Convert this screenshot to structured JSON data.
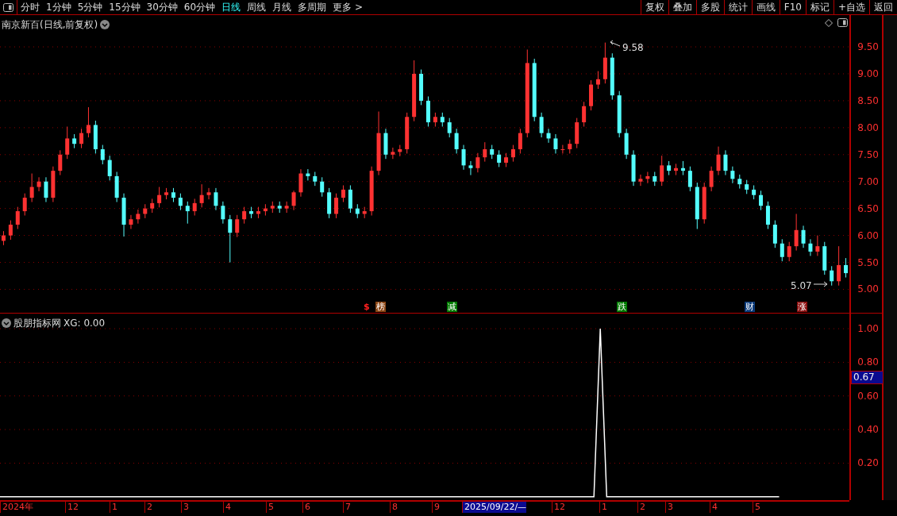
{
  "toolbar": {
    "periods": [
      {
        "label": "分时",
        "selected": false
      },
      {
        "label": "1分钟",
        "selected": false
      },
      {
        "label": "5分钟",
        "selected": false
      },
      {
        "label": "15分钟",
        "selected": false
      },
      {
        "label": "30分钟",
        "selected": false
      },
      {
        "label": "60分钟",
        "selected": false
      },
      {
        "label": "日线",
        "selected": true
      },
      {
        "label": "周线",
        "selected": false
      },
      {
        "label": "月线",
        "selected": false
      },
      {
        "label": "多周期",
        "selected": false
      }
    ],
    "more": "更多 >",
    "buttons": [
      "复权",
      "叠加",
      "多股",
      "统计",
      "画线",
      "F10",
      "标记",
      "+自选",
      "返回"
    ]
  },
  "price_pane": {
    "title": "南京新百(日线,前复权)",
    "high_label": "9.58",
    "low_label": "5.07",
    "chart_data": {
      "type": "candlestick",
      "ylim": [
        4.55,
        10.09
      ],
      "grid": true,
      "yticks": [
        {
          "value": 9.5,
          "label": "9.50"
        },
        {
          "value": 9,
          "label": "9.00"
        },
        {
          "value": 8.5,
          "label": "8.50"
        },
        {
          "value": 8,
          "label": "8.00"
        },
        {
          "value": 7.5,
          "label": "7.50"
        },
        {
          "value": 7,
          "label": "7.00"
        },
        {
          "value": 6.5,
          "label": "6.50"
        },
        {
          "value": 6,
          "label": "6.00"
        },
        {
          "value": 5.5,
          "label": "5.50"
        },
        {
          "value": 5,
          "label": "5.00"
        }
      ],
      "categories": [
        null,
        null,
        null,
        null,
        null,
        null,
        null,
        null,
        null,
        null,
        null,
        null,
        null,
        null,
        null,
        null,
        null,
        null,
        null,
        null,
        null,
        null,
        null,
        null,
        null,
        null,
        null,
        null,
        null,
        null,
        null,
        null,
        null,
        null,
        null,
        null,
        null,
        null,
        null,
        null,
        null,
        null,
        null,
        null,
        null,
        null,
        null,
        null,
        null,
        null,
        null,
        null,
        null,
        null,
        null,
        null,
        null,
        null,
        null,
        null,
        null,
        null,
        null,
        null,
        null,
        null,
        null,
        null,
        null,
        null,
        null,
        null,
        null,
        null,
        null,
        null,
        null,
        null,
        null,
        null,
        null,
        null,
        null,
        null,
        null,
        null,
        null,
        null,
        null,
        null,
        null,
        null,
        null,
        null,
        null,
        null,
        null,
        null,
        null,
        null,
        null,
        null,
        null,
        null,
        null,
        null,
        null,
        null,
        null,
        null,
        null,
        null,
        null,
        null,
        null,
        null,
        null,
        null,
        null,
        null
      ],
      "ohlc": [
        [
          5.9,
          6.08,
          5.82,
          6.0
        ],
        [
          6.0,
          6.28,
          5.92,
          6.2
        ],
        [
          6.2,
          6.53,
          6.12,
          6.45
        ],
        [
          6.45,
          6.78,
          6.37,
          6.7
        ],
        [
          6.7,
          7.15,
          6.62,
          6.9
        ],
        [
          6.9,
          7.08,
          6.82,
          7.0
        ],
        [
          7.0,
          7.08,
          6.62,
          6.7
        ],
        [
          6.7,
          7.28,
          6.62,
          7.2
        ],
        [
          7.2,
          7.58,
          7.12,
          7.5
        ],
        [
          7.5,
          8.02,
          7.42,
          7.8
        ],
        [
          7.8,
          7.88,
          7.62,
          7.7
        ],
        [
          7.7,
          7.98,
          7.62,
          7.9
        ],
        [
          7.9,
          8.38,
          7.82,
          8.05
        ],
        [
          8.05,
          8.13,
          7.52,
          7.6
        ],
        [
          7.6,
          7.68,
          7.32,
          7.4
        ],
        [
          7.4,
          7.48,
          7.02,
          7.1
        ],
        [
          7.1,
          7.18,
          6.62,
          6.7
        ],
        [
          6.7,
          6.78,
          5.98,
          6.2
        ],
        [
          6.2,
          6.38,
          6.12,
          6.3
        ],
        [
          6.3,
          6.48,
          6.22,
          6.4
        ],
        [
          6.4,
          6.58,
          6.32,
          6.5
        ],
        [
          6.5,
          6.68,
          6.42,
          6.6
        ],
        [
          6.6,
          6.9,
          6.52,
          6.75
        ],
        [
          6.75,
          6.88,
          6.67,
          6.8
        ],
        [
          6.8,
          6.88,
          6.62,
          6.7
        ],
        [
          6.7,
          6.78,
          6.47,
          6.55
        ],
        [
          6.55,
          6.63,
          6.22,
          6.45
        ],
        [
          6.45,
          6.68,
          6.37,
          6.6
        ],
        [
          6.6,
          6.95,
          6.52,
          6.75
        ],
        [
          6.75,
          6.88,
          6.67,
          6.8
        ],
        [
          6.8,
          6.88,
          6.47,
          6.55
        ],
        [
          6.55,
          6.63,
          6.22,
          6.3
        ],
        [
          6.3,
          6.38,
          5.5,
          6.05
        ],
        [
          6.05,
          6.38,
          5.97,
          6.3
        ],
        [
          6.3,
          6.53,
          6.22,
          6.45
        ],
        [
          6.45,
          6.53,
          6.32,
          6.4
        ],
        [
          6.4,
          6.53,
          6.32,
          6.45
        ],
        [
          6.45,
          6.58,
          6.37,
          6.5
        ],
        [
          6.5,
          6.63,
          6.42,
          6.55
        ],
        [
          6.55,
          6.63,
          6.42,
          6.5
        ],
        [
          6.5,
          6.63,
          6.42,
          6.55
        ],
        [
          6.55,
          6.83,
          6.47,
          6.8
        ],
        [
          6.8,
          7.23,
          6.72,
          7.15
        ],
        [
          7.15,
          7.23,
          7.02,
          7.1
        ],
        [
          7.1,
          7.18,
          6.92,
          7.0
        ],
        [
          7.0,
          7.08,
          6.72,
          6.8
        ],
        [
          6.8,
          6.88,
          6.32,
          6.4
        ],
        [
          6.4,
          6.78,
          6.32,
          6.7
        ],
        [
          6.7,
          6.93,
          6.62,
          6.85
        ],
        [
          6.85,
          6.93,
          6.42,
          6.5
        ],
        [
          6.5,
          6.58,
          6.32,
          6.4
        ],
        [
          6.4,
          6.53,
          6.32,
          6.45
        ],
        [
          6.45,
          7.28,
          6.37,
          7.2
        ],
        [
          7.2,
          8.3,
          7.12,
          7.9
        ],
        [
          7.9,
          7.98,
          7.42,
          7.5
        ],
        [
          7.5,
          7.63,
          7.42,
          7.55
        ],
        [
          7.55,
          7.68,
          7.47,
          7.6
        ],
        [
          7.6,
          8.28,
          7.52,
          8.2
        ],
        [
          8.2,
          9.25,
          8.12,
          9.0
        ],
        [
          9.0,
          9.08,
          8.42,
          8.5
        ],
        [
          8.5,
          8.58,
          8.02,
          8.1
        ],
        [
          8.1,
          8.28,
          8.02,
          8.2
        ],
        [
          8.2,
          8.28,
          8.02,
          8.1
        ],
        [
          8.1,
          8.18,
          7.82,
          7.9
        ],
        [
          7.9,
          7.98,
          7.52,
          7.6
        ],
        [
          7.6,
          7.68,
          7.22,
          7.3
        ],
        [
          7.3,
          7.38,
          7.12,
          7.25
        ],
        [
          7.25,
          7.53,
          7.17,
          7.45
        ],
        [
          7.45,
          7.73,
          7.37,
          7.6
        ],
        [
          7.6,
          7.68,
          7.42,
          7.5
        ],
        [
          7.5,
          7.58,
          7.27,
          7.35
        ],
        [
          7.35,
          7.53,
          7.27,
          7.45
        ],
        [
          7.45,
          7.68,
          7.37,
          7.6
        ],
        [
          7.6,
          7.98,
          7.52,
          7.9
        ],
        [
          7.9,
          9.45,
          7.82,
          9.2
        ],
        [
          9.2,
          9.28,
          8.12,
          8.2
        ],
        [
          8.2,
          8.28,
          7.82,
          7.9
        ],
        [
          7.9,
          7.98,
          7.72,
          7.8
        ],
        [
          7.8,
          7.88,
          7.52,
          7.6
        ],
        [
          7.6,
          7.68,
          7.52,
          7.6
        ],
        [
          7.6,
          7.78,
          7.52,
          7.7
        ],
        [
          7.7,
          8.18,
          7.62,
          8.1
        ],
        [
          8.1,
          8.48,
          8.02,
          8.4
        ],
        [
          8.4,
          8.88,
          8.32,
          8.8
        ],
        [
          8.8,
          9.05,
          8.72,
          8.9
        ],
        [
          8.9,
          9.58,
          8.82,
          9.3
        ],
        [
          9.3,
          9.38,
          8.52,
          8.6
        ],
        [
          8.6,
          8.68,
          7.82,
          7.9
        ],
        [
          7.9,
          7.98,
          7.42,
          7.5
        ],
        [
          7.5,
          7.58,
          6.92,
          7.0
        ],
        [
          7.0,
          7.13,
          6.92,
          7.05
        ],
        [
          7.05,
          7.18,
          6.97,
          7.1
        ],
        [
          7.1,
          7.18,
          6.92,
          7.0
        ],
        [
          7.0,
          7.48,
          6.92,
          7.3
        ],
        [
          7.3,
          7.38,
          7.12,
          7.2
        ],
        [
          7.2,
          7.33,
          7.12,
          7.25
        ],
        [
          7.25,
          7.38,
          7.12,
          7.2
        ],
        [
          7.2,
          7.28,
          6.82,
          6.9
        ],
        [
          6.9,
          6.98,
          6.12,
          6.3
        ],
        [
          6.3,
          6.98,
          6.22,
          6.9
        ],
        [
          6.9,
          7.28,
          6.82,
          7.2
        ],
        [
          7.2,
          7.65,
          7.12,
          7.5
        ],
        [
          7.5,
          7.58,
          7.12,
          7.2
        ],
        [
          7.2,
          7.28,
          6.97,
          7.05
        ],
        [
          7.05,
          7.13,
          6.87,
          6.95
        ],
        [
          6.95,
          7.03,
          6.77,
          6.85
        ],
        [
          6.85,
          6.93,
          6.67,
          6.75
        ],
        [
          6.75,
          6.83,
          6.47,
          6.55
        ],
        [
          6.55,
          6.63,
          6.12,
          6.2
        ],
        [
          6.2,
          6.28,
          5.77,
          5.85
        ],
        [
          5.85,
          5.93,
          5.52,
          5.6
        ],
        [
          5.6,
          5.88,
          5.52,
          5.8
        ],
        [
          5.8,
          6.4,
          5.72,
          6.1
        ],
        [
          6.1,
          6.18,
          5.77,
          5.85
        ],
        [
          5.85,
          5.93,
          5.62,
          5.7
        ],
        [
          5.7,
          6.0,
          5.62,
          5.8
        ],
        [
          5.8,
          5.88,
          5.27,
          5.35
        ],
        [
          5.35,
          5.43,
          5.07,
          5.15
        ],
        [
          5.15,
          5.8,
          5.07,
          5.45
        ],
        [
          5.45,
          5.58,
          5.22,
          5.3
        ]
      ]
    },
    "markers": [
      {
        "text": "$",
        "color": "#ff2020",
        "kind": "symbol"
      },
      {
        "text": "榜",
        "color": "#8b4513",
        "kind": "tag"
      },
      {
        "text": "减",
        "color": "#007a00",
        "kind": "tag"
      },
      {
        "text": "跌",
        "color": "#007a00",
        "kind": "tag"
      },
      {
        "text": "财",
        "color": "#0a3a7a",
        "kind": "tag"
      },
      {
        "text": "涨",
        "color": "#8b1010",
        "kind": "tag"
      }
    ]
  },
  "indicator_pane": {
    "title": "股朋指标网",
    "readout": ": 0.00",
    "cursor_value": "0.67",
    "chart_data": {
      "type": "line",
      "ylim": [
        -0.02,
        1.09
      ],
      "grid": true,
      "yticks": [
        {
          "value": 1,
          "label": "1.00"
        },
        {
          "value": 0.8,
          "label": "0.80"
        },
        {
          "value": 0.6,
          "label": "0.60"
        },
        {
          "value": 0.4,
          "label": "0.40"
        },
        {
          "value": 0.2,
          "label": "0.20"
        }
      ],
      "series": [
        {
          "name": "XG",
          "color": "#ffffff",
          "values": [
            0,
            0,
            0,
            0,
            0,
            0,
            0,
            0,
            0,
            0,
            0,
            0,
            0,
            0,
            0,
            0,
            0,
            0,
            0,
            0,
            0,
            0,
            0,
            0,
            0,
            0,
            0,
            0,
            0,
            0,
            0,
            0,
            0,
            0,
            0,
            0,
            0,
            0,
            0,
            0,
            0,
            0,
            0,
            0,
            0,
            0,
            0,
            0,
            0,
            0,
            0,
            0,
            0,
            0,
            0,
            0,
            0,
            0,
            0,
            0,
            0,
            0,
            0,
            0,
            0,
            0,
            0,
            0,
            0,
            0,
            0,
            0,
            0,
            0,
            0,
            0,
            0,
            0,
            0,
            0,
            0,
            0,
            0,
            0,
            0,
            0,
            0,
            0,
            0,
            0,
            0,
            0,
            0,
            0,
            1,
            0,
            0,
            0,
            0,
            0,
            0,
            0,
            0,
            0,
            0,
            0,
            0,
            0,
            0,
            0,
            0,
            0,
            0,
            0,
            0,
            0,
            0,
            0,
            0,
            0,
            0,
            0,
            0,
            null,
            null,
            null,
            null,
            null,
            null,
            null,
            null,
            null,
            null,
            null
          ]
        }
      ]
    }
  },
  "time_axis": [
    {
      "label": "2024年",
      "selected": false
    },
    {
      "label": "12",
      "selected": false
    },
    {
      "label": "1",
      "selected": false
    },
    {
      "label": "2",
      "selected": false
    },
    {
      "label": "3",
      "selected": false
    },
    {
      "label": "4",
      "selected": false
    },
    {
      "label": "5",
      "selected": false
    },
    {
      "label": "6",
      "selected": false
    },
    {
      "label": "7",
      "selected": false
    },
    {
      "label": "8",
      "selected": false
    },
    {
      "label": "9",
      "selected": false
    },
    {
      "label": "2025/09/22/—",
      "selected": true
    },
    {
      "label": "12",
      "selected": false
    },
    {
      "label": "1",
      "selected": false
    },
    {
      "label": "2",
      "selected": false
    },
    {
      "label": "3",
      "selected": false
    },
    {
      "label": "4",
      "selected": false
    },
    {
      "label": "5",
      "selected": false
    }
  ]
}
